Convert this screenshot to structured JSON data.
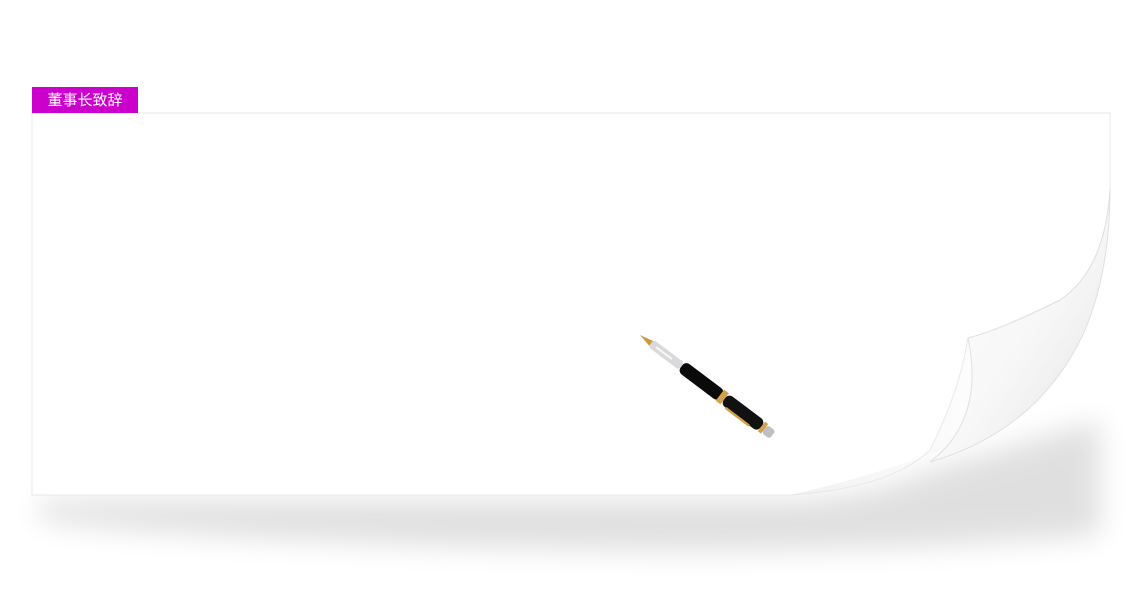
{
  "section": {
    "title": "董事长致辞"
  },
  "colors": {
    "title_background": "#cc00cc",
    "title_text": "#ffffff",
    "paper": "#ffffff",
    "pen_body": "#000000",
    "pen_trim": "#d4a14a"
  },
  "icons": {
    "pen": "fountain-pen-icon",
    "page_curl": "page-curl-icon"
  }
}
